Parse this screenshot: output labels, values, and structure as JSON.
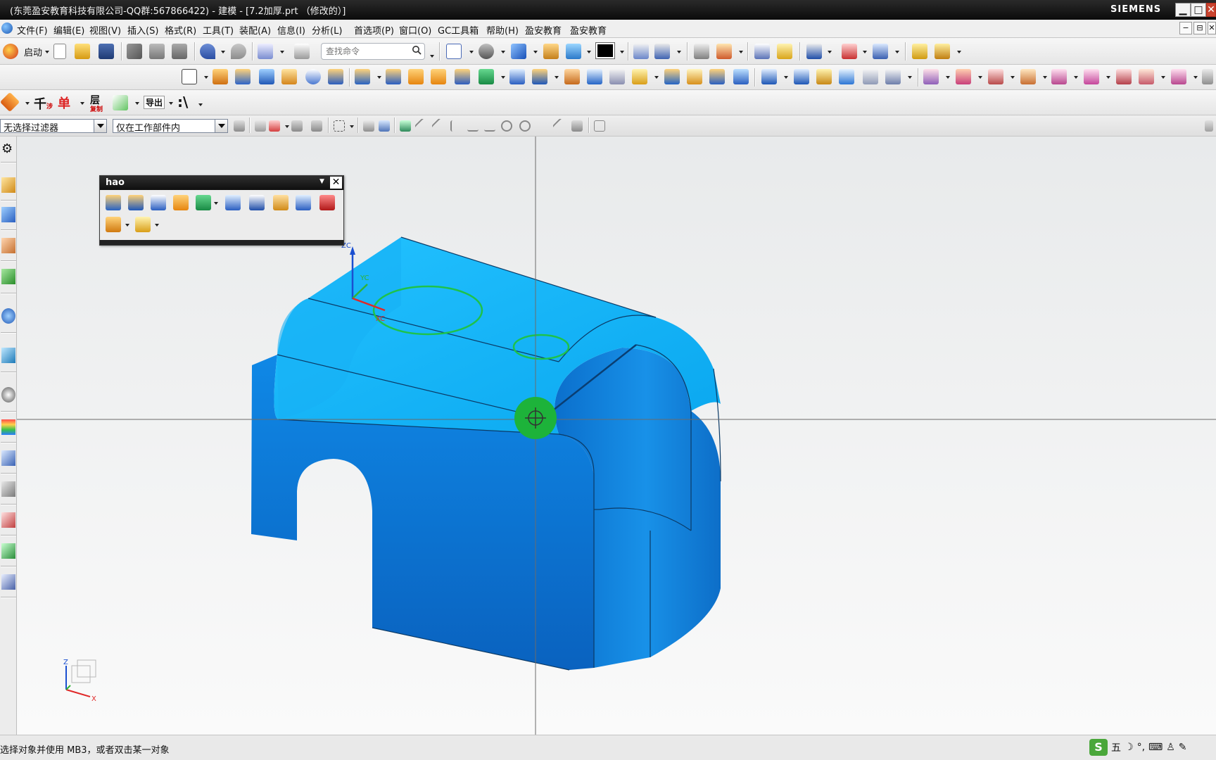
{
  "window": {
    "title": "(东莞盈安教育科技有限公司-QQ群:567866422) - 建模 - [7.2加厚.prt （修改的）]",
    "brand": "SIEMENS",
    "controls": {
      "minimize": "▁",
      "maximize": "□",
      "close": "✕"
    }
  },
  "menubar": {
    "items": [
      "文件(F)",
      "编辑(E)",
      "视图(V)",
      "插入(S)",
      "格式(R)",
      "工具(T)",
      "装配(A)",
      "信息(I)",
      "分析(L)",
      "首选项(P)",
      "窗口(O)",
      "GC工具箱",
      "帮助(H)",
      "盈安教育",
      "盈安教育"
    ],
    "doc_controls": [
      "−",
      "⊟",
      "✕"
    ]
  },
  "toolbar1": {
    "start_label": "启动",
    "search_placeholder": "查找命令",
    "color_swatch": "#000000"
  },
  "toolbar3": {
    "btn_qian": "千",
    "btn_qian_sub": "涉",
    "btn_dan": "单",
    "btn_ceng": "层",
    "btn_ceng_sub": "复制",
    "btn_export": "导出",
    "btn_path": ":\\"
  },
  "selection": {
    "filter_value": "无选择过滤器",
    "scope_value": "仅在工作部件内"
  },
  "hao_panel": {
    "title": "hao"
  },
  "wcs": {
    "zc": "ZC",
    "yc": "YC",
    "xc": "XC"
  },
  "triad": {
    "z": "Z",
    "x": "X"
  },
  "status": {
    "prompt": "选择对象并使用 MB3，或者双击某一对象"
  },
  "ime": {
    "logo": "S",
    "mode": "五",
    "moon": "☽",
    "punct": "°,",
    "keyboard": "⌨",
    "user": "♙",
    "tool": "✎"
  },
  "colors": {
    "model_top": "#1ab2f3",
    "model_side": "#0f7ad6",
    "model_dark": "#0a5fb8",
    "highlight": "#1db33a",
    "crosshair": "#6b6b6b"
  }
}
